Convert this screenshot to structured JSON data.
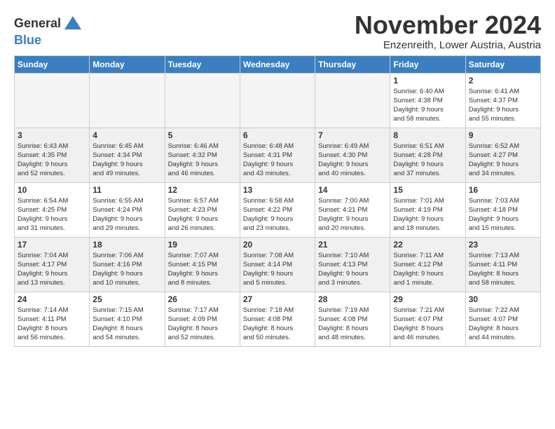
{
  "header": {
    "logo_line1": "General",
    "logo_line2": "Blue",
    "title": "November 2024",
    "subtitle": "Enzenreith, Lower Austria, Austria"
  },
  "days_of_week": [
    "Sunday",
    "Monday",
    "Tuesday",
    "Wednesday",
    "Thursday",
    "Friday",
    "Saturday"
  ],
  "weeks": [
    [
      {
        "num": "",
        "info": "",
        "empty": true
      },
      {
        "num": "",
        "info": "",
        "empty": true
      },
      {
        "num": "",
        "info": "",
        "empty": true
      },
      {
        "num": "",
        "info": "",
        "empty": true
      },
      {
        "num": "",
        "info": "",
        "empty": true
      },
      {
        "num": "1",
        "info": "Sunrise: 6:40 AM\nSunset: 4:38 PM\nDaylight: 9 hours\nand 58 minutes.",
        "empty": false
      },
      {
        "num": "2",
        "info": "Sunrise: 6:41 AM\nSunset: 4:37 PM\nDaylight: 9 hours\nand 55 minutes.",
        "empty": false
      }
    ],
    [
      {
        "num": "3",
        "info": "Sunrise: 6:43 AM\nSunset: 4:35 PM\nDaylight: 9 hours\nand 52 minutes.",
        "empty": false
      },
      {
        "num": "4",
        "info": "Sunrise: 6:45 AM\nSunset: 4:34 PM\nDaylight: 9 hours\nand 49 minutes.",
        "empty": false
      },
      {
        "num": "5",
        "info": "Sunrise: 6:46 AM\nSunset: 4:32 PM\nDaylight: 9 hours\nand 46 minutes.",
        "empty": false
      },
      {
        "num": "6",
        "info": "Sunrise: 6:48 AM\nSunset: 4:31 PM\nDaylight: 9 hours\nand 43 minutes.",
        "empty": false
      },
      {
        "num": "7",
        "info": "Sunrise: 6:49 AM\nSunset: 4:30 PM\nDaylight: 9 hours\nand 40 minutes.",
        "empty": false
      },
      {
        "num": "8",
        "info": "Sunrise: 6:51 AM\nSunset: 4:28 PM\nDaylight: 9 hours\nand 37 minutes.",
        "empty": false
      },
      {
        "num": "9",
        "info": "Sunrise: 6:52 AM\nSunset: 4:27 PM\nDaylight: 9 hours\nand 34 minutes.",
        "empty": false
      }
    ],
    [
      {
        "num": "10",
        "info": "Sunrise: 6:54 AM\nSunset: 4:25 PM\nDaylight: 9 hours\nand 31 minutes.",
        "empty": false
      },
      {
        "num": "11",
        "info": "Sunrise: 6:55 AM\nSunset: 4:24 PM\nDaylight: 9 hours\nand 29 minutes.",
        "empty": false
      },
      {
        "num": "12",
        "info": "Sunrise: 6:57 AM\nSunset: 4:23 PM\nDaylight: 9 hours\nand 26 minutes.",
        "empty": false
      },
      {
        "num": "13",
        "info": "Sunrise: 6:58 AM\nSunset: 4:22 PM\nDaylight: 9 hours\nand 23 minutes.",
        "empty": false
      },
      {
        "num": "14",
        "info": "Sunrise: 7:00 AM\nSunset: 4:21 PM\nDaylight: 9 hours\nand 20 minutes.",
        "empty": false
      },
      {
        "num": "15",
        "info": "Sunrise: 7:01 AM\nSunset: 4:19 PM\nDaylight: 9 hours\nand 18 minutes.",
        "empty": false
      },
      {
        "num": "16",
        "info": "Sunrise: 7:03 AM\nSunset: 4:18 PM\nDaylight: 9 hours\nand 15 minutes.",
        "empty": false
      }
    ],
    [
      {
        "num": "17",
        "info": "Sunrise: 7:04 AM\nSunset: 4:17 PM\nDaylight: 9 hours\nand 13 minutes.",
        "empty": false
      },
      {
        "num": "18",
        "info": "Sunrise: 7:06 AM\nSunset: 4:16 PM\nDaylight: 9 hours\nand 10 minutes.",
        "empty": false
      },
      {
        "num": "19",
        "info": "Sunrise: 7:07 AM\nSunset: 4:15 PM\nDaylight: 9 hours\nand 8 minutes.",
        "empty": false
      },
      {
        "num": "20",
        "info": "Sunrise: 7:08 AM\nSunset: 4:14 PM\nDaylight: 9 hours\nand 5 minutes.",
        "empty": false
      },
      {
        "num": "21",
        "info": "Sunrise: 7:10 AM\nSunset: 4:13 PM\nDaylight: 9 hours\nand 3 minutes.",
        "empty": false
      },
      {
        "num": "22",
        "info": "Sunrise: 7:11 AM\nSunset: 4:12 PM\nDaylight: 9 hours\nand 1 minute.",
        "empty": false
      },
      {
        "num": "23",
        "info": "Sunrise: 7:13 AM\nSunset: 4:11 PM\nDaylight: 8 hours\nand 58 minutes.",
        "empty": false
      }
    ],
    [
      {
        "num": "24",
        "info": "Sunrise: 7:14 AM\nSunset: 4:11 PM\nDaylight: 8 hours\nand 56 minutes.",
        "empty": false
      },
      {
        "num": "25",
        "info": "Sunrise: 7:15 AM\nSunset: 4:10 PM\nDaylight: 8 hours\nand 54 minutes.",
        "empty": false
      },
      {
        "num": "26",
        "info": "Sunrise: 7:17 AM\nSunset: 4:09 PM\nDaylight: 8 hours\nand 52 minutes.",
        "empty": false
      },
      {
        "num": "27",
        "info": "Sunrise: 7:18 AM\nSunset: 4:08 PM\nDaylight: 8 hours\nand 50 minutes.",
        "empty": false
      },
      {
        "num": "28",
        "info": "Sunrise: 7:19 AM\nSunset: 4:08 PM\nDaylight: 8 hours\nand 48 minutes.",
        "empty": false
      },
      {
        "num": "29",
        "info": "Sunrise: 7:21 AM\nSunset: 4:07 PM\nDaylight: 8 hours\nand 46 minutes.",
        "empty": false
      },
      {
        "num": "30",
        "info": "Sunrise: 7:22 AM\nSunset: 4:07 PM\nDaylight: 8 hours\nand 44 minutes.",
        "empty": false
      }
    ]
  ]
}
